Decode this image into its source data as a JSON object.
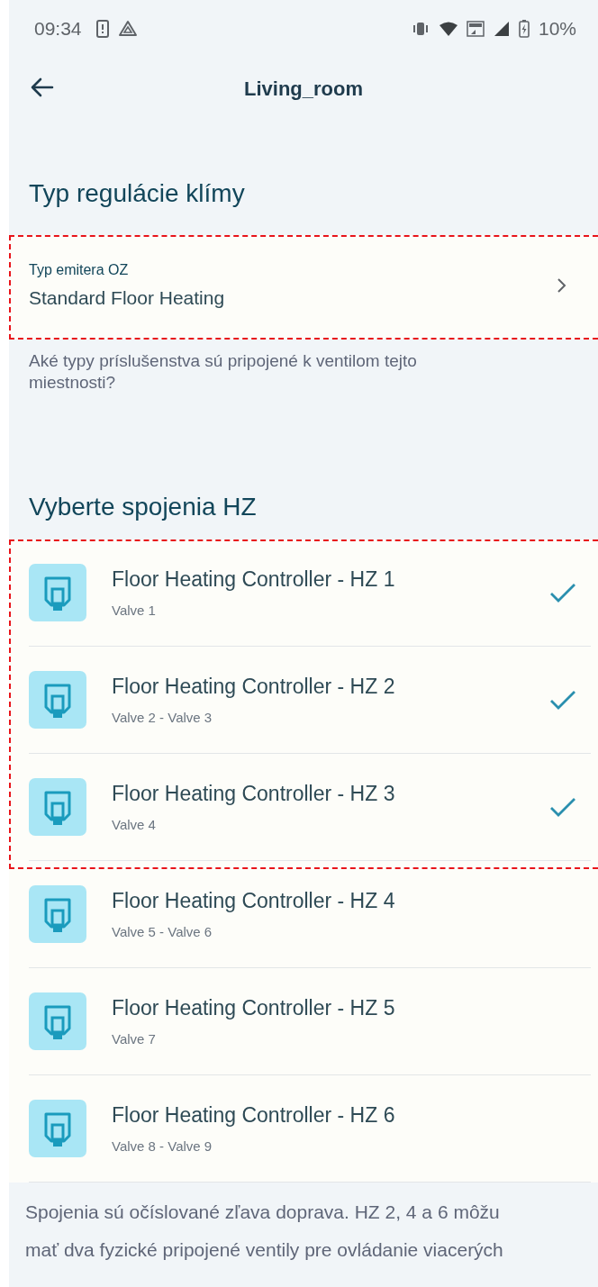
{
  "status_bar": {
    "time": "09:34",
    "battery": "10%"
  },
  "header": {
    "title": "Living_room"
  },
  "climate_section": {
    "heading": "Typ regulácie klímy",
    "highlighted": true,
    "emitter": {
      "label": "Typ emitera OZ",
      "value": "Standard Floor Heating"
    },
    "hint": "Aké typy príslušenstva sú pripojené k ventilom tejto miestnosti?"
  },
  "connections_section": {
    "heading": "Vyberte spojenia HZ",
    "items": [
      {
        "title": "Floor Heating Controller - HZ 1",
        "subtitle": "Valve 1",
        "selected": true
      },
      {
        "title": "Floor Heating Controller - HZ 2",
        "subtitle": "Valve 2 - Valve 3",
        "selected": true
      },
      {
        "title": "Floor Heating Controller - HZ 3",
        "subtitle": "Valve 4",
        "selected": true
      },
      {
        "title": "Floor Heating Controller - HZ 4",
        "subtitle": "Valve 5 - Valve 6",
        "selected": false
      },
      {
        "title": "Floor Heating Controller - HZ 5",
        "subtitle": "Valve 7",
        "selected": false
      },
      {
        "title": "Floor Heating Controller - HZ 6",
        "subtitle": "Valve 8 - Valve 9",
        "selected": false
      }
    ],
    "footnote": "Spojenia sú očíslované zľava doprava.  HZ 2, 4 a 6 môžu mať dva fyzické pripojené ventily pre ovládanie viacerých"
  }
}
